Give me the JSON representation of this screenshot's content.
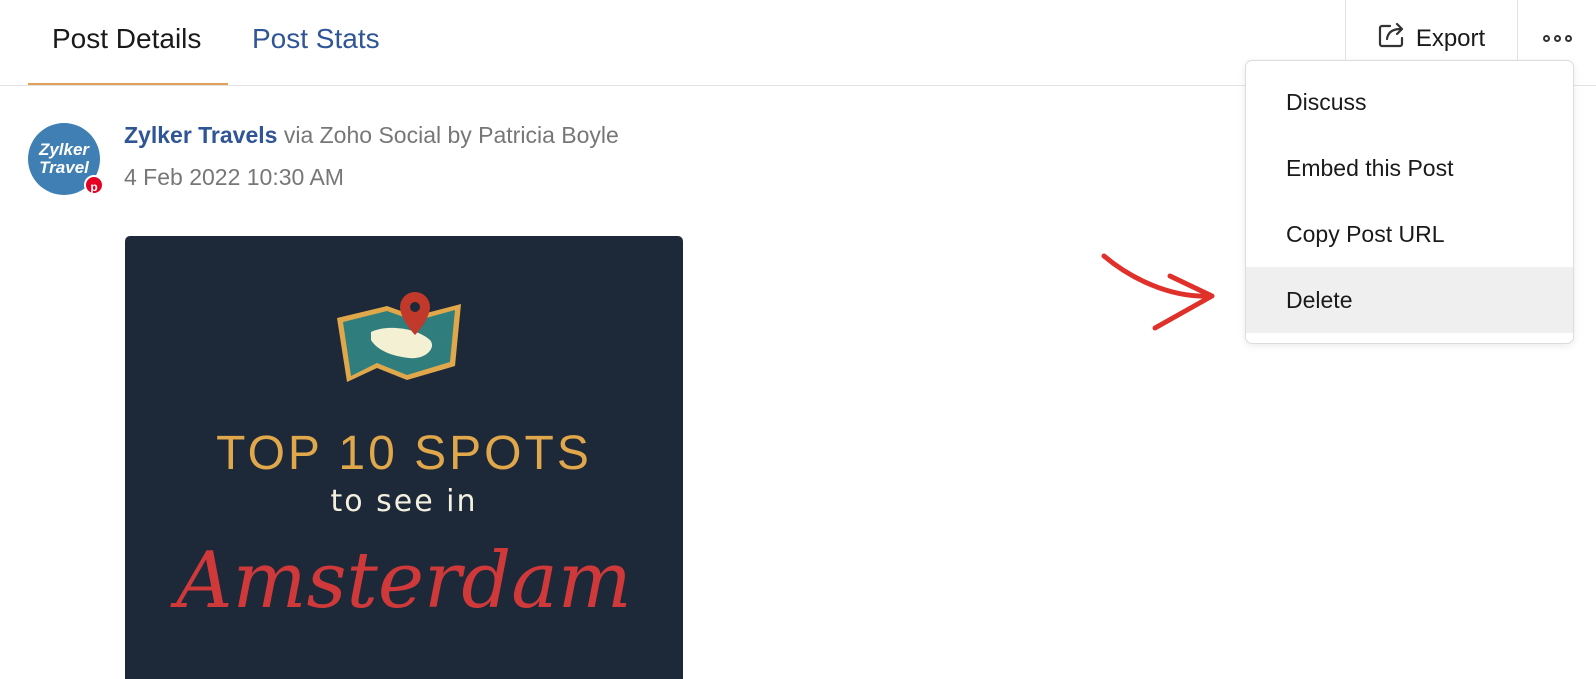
{
  "tabs": [
    {
      "label": "Post Details",
      "active": true
    },
    {
      "label": "Post Stats",
      "active": false
    }
  ],
  "toolbar": {
    "export_label": "Export",
    "export_icon": "export-icon",
    "more_icon": "more-options-icon"
  },
  "post": {
    "author": "Zylker Travels",
    "via_text": " via Zoho Social by Patricia Boyle",
    "date": "4 Feb 2022 10:30 AM",
    "avatar_text_line1": "Zylker",
    "avatar_text_line2": "Travel",
    "network_icon": "pinterest-icon",
    "image_text": {
      "line1": "TOP 10 SPOTS",
      "line2": "to see in",
      "line3": "Amsterdam"
    }
  },
  "menu": {
    "items": [
      "Discuss",
      "Embed this Post",
      "Copy Post URL",
      "Delete"
    ],
    "highlighted_index": 3
  },
  "colors": {
    "accent_link": "#2f5597",
    "tab_underline": "#e0a15a",
    "image_bg": "#1d2839",
    "arrow": "#e0302a"
  }
}
